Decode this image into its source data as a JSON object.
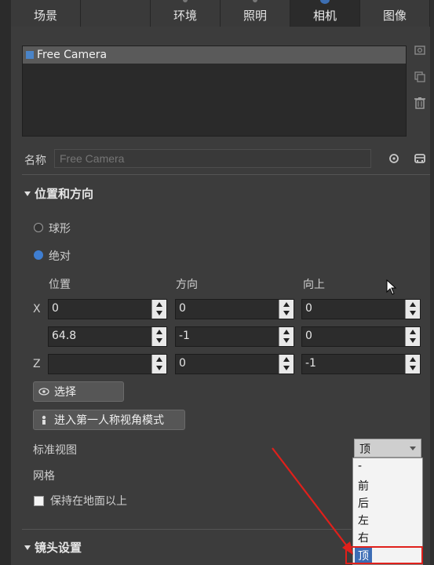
{
  "tabs": [
    {
      "label": "场景",
      "icon": "none"
    },
    {
      "label": "",
      "icon": "none"
    },
    {
      "label": "环境",
      "icon": "plain"
    },
    {
      "label": "照明",
      "icon": "plain"
    },
    {
      "label": "相机",
      "icon": "camera"
    },
    {
      "label": "图像",
      "icon": "none"
    }
  ],
  "cameras": {
    "items": [
      {
        "label": "Free Camera"
      }
    ]
  },
  "name_row": {
    "label": "名称",
    "placeholder": "Free Camera"
  },
  "position_section": {
    "title": "位置和方向",
    "mode_sphere": "球形",
    "mode_absolute": "绝对",
    "selected_mode": "absolute",
    "headers": {
      "position": "位置",
      "direction": "方向",
      "up": "向上"
    },
    "rows": [
      {
        "axis": "X",
        "position": "0",
        "direction": "0",
        "up": "0"
      },
      {
        "axis": "",
        "position": "64.8",
        "direction": "-1",
        "up": "0"
      },
      {
        "axis": "Z",
        "position": "",
        "direction": "0",
        "up": "-1"
      }
    ],
    "select_button": "选择",
    "first_person_button": "进入第一人称视角模式"
  },
  "standard_view": {
    "label": "标准视图",
    "value": "顶",
    "options": [
      "-",
      "前",
      "后",
      "左",
      "右",
      "顶"
    ]
  },
  "grid_label": "网格",
  "keep_above_ground": {
    "label": "保持在地面以上",
    "checked": false
  },
  "lens_section": {
    "title": "镜头设置"
  },
  "colors": {
    "accent": "#3f7ed1",
    "arrow": "#e0201b"
  }
}
